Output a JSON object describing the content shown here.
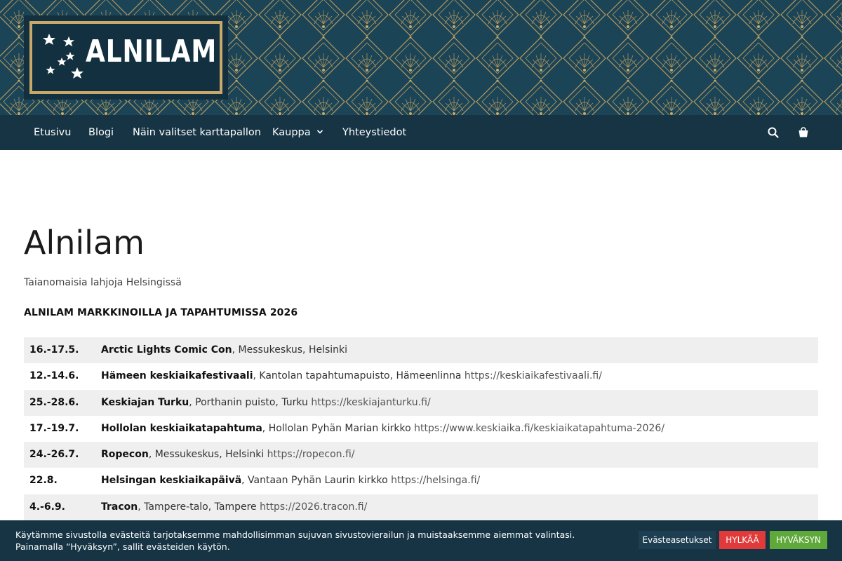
{
  "site": {
    "logo_text": "ALNILAM",
    "colors": {
      "banner_bg": "#1b4457",
      "nav_bg": "#163444",
      "gold": "#c9a968",
      "reject": "#e03a3a",
      "accept": "#5fa83a"
    }
  },
  "nav": {
    "items": [
      {
        "label": "Etusivu"
      },
      {
        "label": "Blogi"
      },
      {
        "label": "Näin valitset karttapallon"
      },
      {
        "label": "Kauppa",
        "has_dropdown": true
      },
      {
        "label": "Yhteystiedot"
      }
    ],
    "search_icon": "search-icon",
    "cart_icon": "shopping-bag-icon"
  },
  "main": {
    "title": "Alnilam",
    "tagline": "Taianomaisia lahjoja Helsingissä",
    "heading": "ALNILAM MARKKINOILLA JA TAPAHTUMISSA 2026",
    "events": [
      {
        "date": "16.-17.5.",
        "name": "Arctic Lights Comic Con",
        "place": ", Messukeskus, Helsinki",
        "link": ""
      },
      {
        "date": "12.-14.6.",
        "name": "Hämeen keskiaikafestivaali",
        "place": ", Kantolan tapahtumapuisto, Hämeenlinna ",
        "link": "https://keskiaikafestivaali.fi/"
      },
      {
        "date": "25.-28.6.",
        "name": "Keskiajan Turku",
        "place": ", Porthanin puisto, Turku ",
        "link": "https://keskiajanturku.fi/"
      },
      {
        "date": "17.-19.7.",
        "name": "Hollolan keskiaikatapahtuma",
        "place": ", Hollolan Pyhän Marian kirkko ",
        "link": "https://www.keskiaika.fi/keskiaikatapahtuma-2026/"
      },
      {
        "date": "24.-26.7.",
        "name": "Ropecon",
        "place": ", Messukeskus, Helsinki ",
        "link": "https://ropecon.fi/"
      },
      {
        "date": "22.8.",
        "name": "Helsingan keskiaikapäivä",
        "place": ", Vantaan Pyhän Laurin kirkko ",
        "link": "https://helsinga.fi/"
      },
      {
        "date": "4.-6.9.",
        "name": "Tracon",
        "place": ", Tampere-talo, Tampere ",
        "link": "https://2026.tracon.fi/"
      }
    ]
  },
  "cookie": {
    "line1": "Käytämme sivustolla evästeitä tarjotaksemme mahdollisimman sujuvan sivustovierailun ja muistaaksemme aiemmat valintasi.",
    "line2": "Painamalla “Hyväksyn”, sallit evästeiden käytön.",
    "settings_label": "Evästeasetukset",
    "reject_label": "HYLKÄÄ",
    "accept_label": "HYVÄKSYN"
  }
}
